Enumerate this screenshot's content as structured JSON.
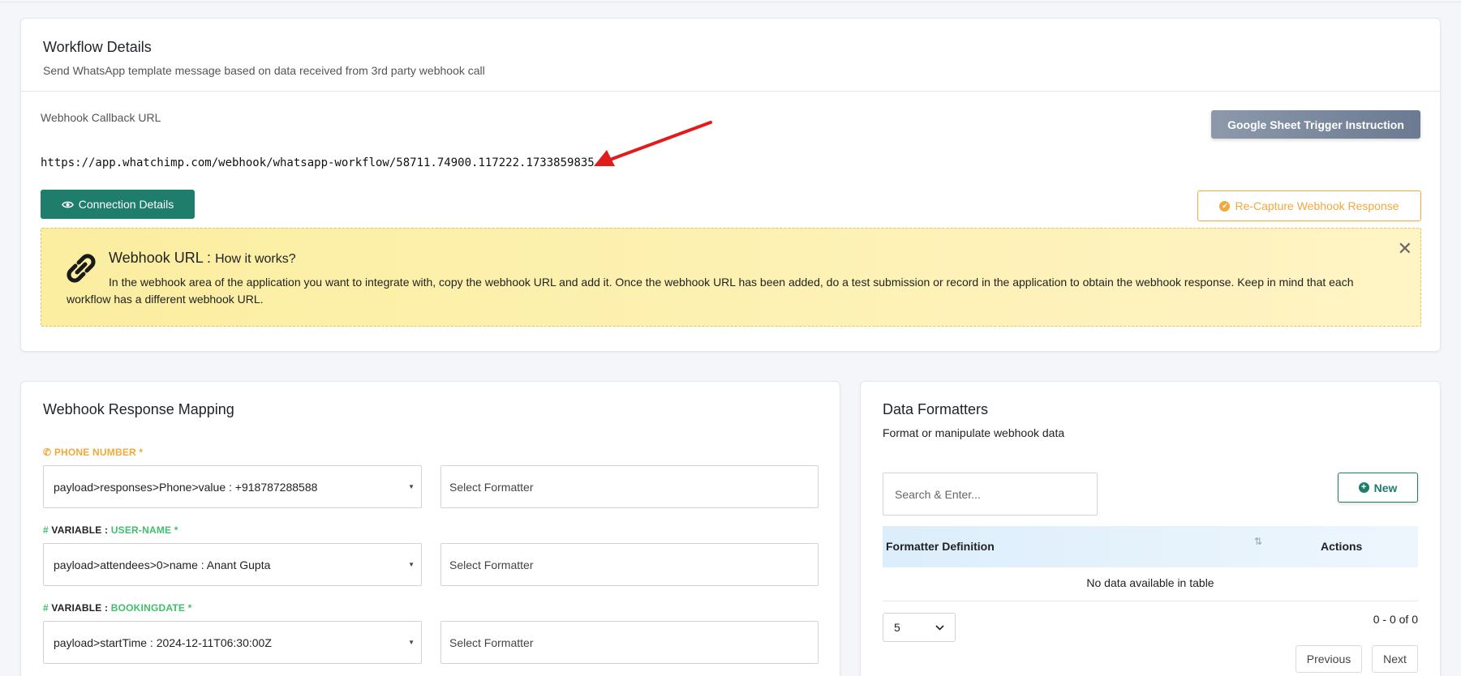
{
  "workflow": {
    "title": "Workflow Details",
    "subtitle": "Send WhatsApp template message based on data received from 3rd party webhook call",
    "callback_label": "Webhook Callback URL",
    "callback_url": "https://app.whatchimp.com/webhook/whatsapp-workflow/58711.74900.117222.1733859835",
    "google_sheet_button": "Google Sheet Trigger Instruction",
    "connection_button": "Connection Details",
    "recapture_button": "Re-Capture Webhook Response",
    "info": {
      "title": "Webhook URL :",
      "title_sub": "How it works?",
      "body": "In the webhook area of the application you want to integrate with, copy the webhook URL and add it. Once the webhook URL has been added, do a test submission or record in the application to obtain the webhook response. Keep in mind that each workflow has a different webhook URL."
    }
  },
  "mapping": {
    "title": "Webhook Response Mapping",
    "fields": [
      {
        "prefix": "PHONE NUMBER *",
        "name": "",
        "value": "payload>responses>Phone>value : +918787288588",
        "formatter_placeholder": "Select Formatter"
      },
      {
        "prefix": "VARIABLE :",
        "name": "USER-NAME *",
        "value": "payload>attendees>0>name : Anant Gupta",
        "formatter_placeholder": "Select Formatter"
      },
      {
        "prefix": "VARIABLE :",
        "name": "BOOKINGDATE *",
        "value": "payload>startTime : 2024-12-11T06:30:00Z",
        "formatter_placeholder": "Select Formatter"
      }
    ]
  },
  "formatters": {
    "title": "Data Formatters",
    "subtitle": "Format or manipulate webhook data",
    "search_placeholder": "Search & Enter...",
    "new_button": "New",
    "columns": [
      "Formatter Definition",
      "Actions"
    ],
    "empty_text": "No data available in table",
    "per_page": "5",
    "count_text": "0 - 0 of 0",
    "prev": "Previous",
    "next": "Next"
  },
  "colors": {
    "accent_green": "#1e7d6b",
    "accent_orange": "#f0a93a",
    "arrow_red": "#e21b1b"
  }
}
